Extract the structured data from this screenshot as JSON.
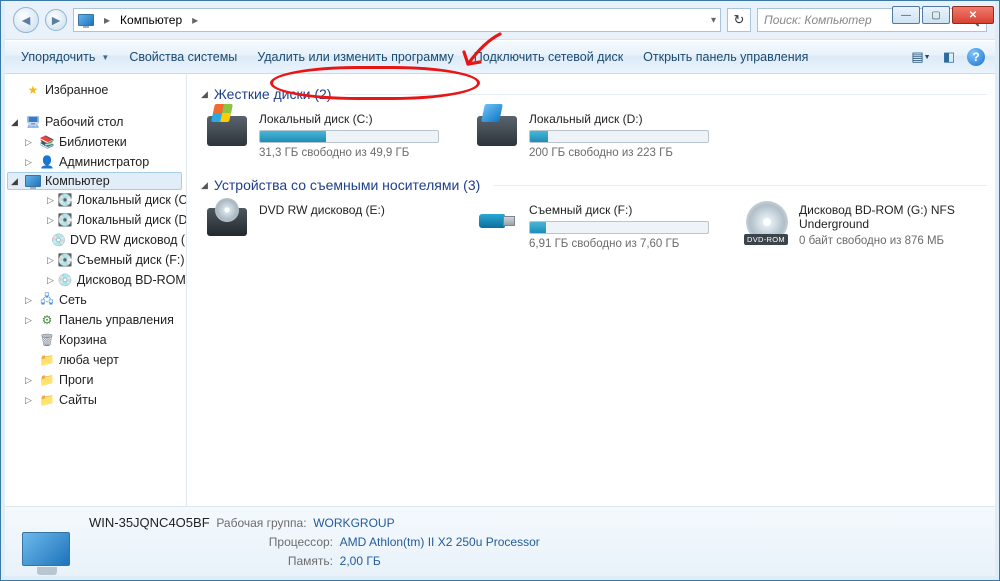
{
  "titlebar": {
    "min": "—",
    "max": "▭",
    "close": "✕"
  },
  "address": {
    "location": "Компьютер",
    "sep": "▸"
  },
  "search": {
    "placeholder": "Поиск: Компьютер"
  },
  "toolbar": {
    "organize": "Упорядочить",
    "properties": "Свойства системы",
    "uninstall": "Удалить или изменить программу",
    "mapdrive": "Подключить сетевой диск",
    "controlpanel": "Открыть панель управления"
  },
  "tree": {
    "favorites": "Избранное",
    "desktop": "Рабочий стол",
    "libraries": "Библиотеки",
    "admin": "Администратор",
    "computer": "Компьютер",
    "drives": {
      "c": "Локальный диск (C:)",
      "d": "Локальный диск (D:)",
      "dvd": "DVD RW дисковод (E:)",
      "f": "Съемный диск (F:)",
      "bd": "Дисковод BD-ROM (G:)"
    },
    "network": "Сеть",
    "panel": "Панель управления",
    "bin": "Корзина",
    "f1": "люба черт",
    "f2": "Проги",
    "f3": "Сайты"
  },
  "groups": {
    "hdd": {
      "title": "Жесткие диски (2)"
    },
    "rem": {
      "title": "Устройства со съемными носителями (3)"
    }
  },
  "drives": {
    "c": {
      "name": "Локальный диск (C:)",
      "sub": "31,3 ГБ свободно из 49,9 ГБ",
      "fill": 37
    },
    "d": {
      "name": "Локальный диск (D:)",
      "sub": "200 ГБ свободно из 223 ГБ",
      "fill": 10
    },
    "dvd": {
      "name": "DVD RW дисковод (E:)"
    },
    "f": {
      "name": "Съемный диск (F:)",
      "sub": "6,91 ГБ свободно из 7,60 ГБ",
      "fill": 9
    },
    "bd": {
      "name": "Дисковод BD-ROM (G:) NFS Underground",
      "sub": "0 байт свободно из 876 МБ",
      "tag": "DVD-ROM"
    }
  },
  "details": {
    "name": "WIN-35JQNC4O5BF",
    "workgroup_lbl": "Рабочая группа:",
    "workgroup": "WORKGROUP",
    "cpu_lbl": "Процессор:",
    "cpu": "AMD Athlon(tm) II X2 250u Processor",
    "mem_lbl": "Память:",
    "mem": "2,00 ГБ"
  }
}
